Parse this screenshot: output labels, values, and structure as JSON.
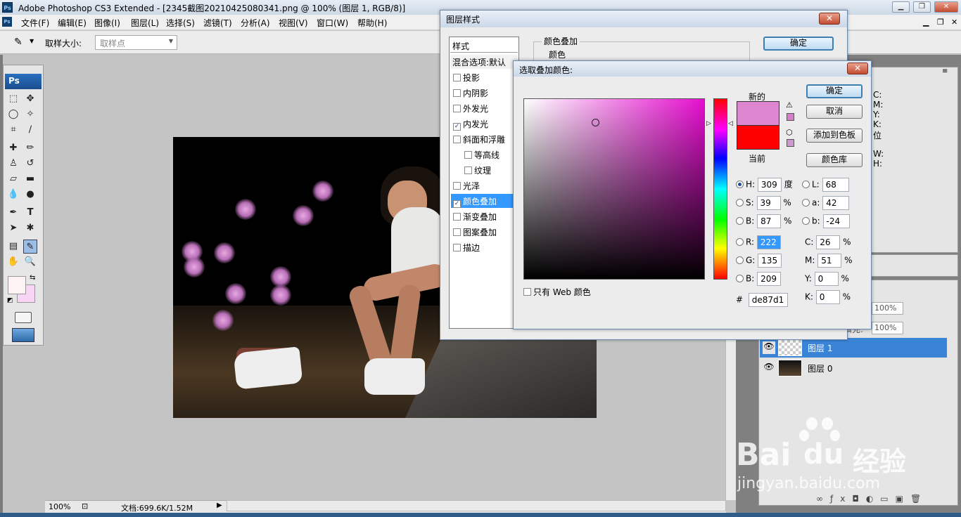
{
  "window": {
    "title": "Adobe Photoshop CS3 Extended - [2345截图20210425080341.png @ 100% (图层 1, RGB/8)]",
    "app_icon": "Ps"
  },
  "menubar": [
    "文件(F)",
    "编辑(E)",
    "图像(I)",
    "图层(L)",
    "选择(S)",
    "滤镜(T)",
    "分析(A)",
    "视图(V)",
    "窗口(W)",
    "帮助(H)"
  ],
  "options": {
    "sample_size_label": "取样大小:",
    "sample_size_value": "取样点"
  },
  "toolbox": {
    "logo": "Ps"
  },
  "status": {
    "zoom": "100%",
    "doc": "文档:699.6K/1.52M"
  },
  "layer_style": {
    "title": "图层样式",
    "list_header": "样式",
    "blend_options": "混合选项:默认",
    "items": [
      {
        "label": "投影",
        "checked": false
      },
      {
        "label": "内阴影",
        "checked": false
      },
      {
        "label": "外发光",
        "checked": false
      },
      {
        "label": "内发光",
        "checked": true
      },
      {
        "label": "斜面和浮雕",
        "checked": false
      },
      {
        "label": "等高线",
        "checked": false
      },
      {
        "label": "纹理",
        "checked": false
      },
      {
        "label": "光泽",
        "checked": false
      },
      {
        "label": "颜色叠加",
        "checked": true
      },
      {
        "label": "渐变叠加",
        "checked": false
      },
      {
        "label": "图案叠加",
        "checked": false
      },
      {
        "label": "描边",
        "checked": false
      }
    ],
    "section_title": "颜色叠加",
    "subsection": "颜色",
    "ok_button": "确定"
  },
  "picker": {
    "title": "选取叠加颜色:",
    "new_label": "新的",
    "current_label": "当前",
    "new_color": "#de87d1",
    "current_color": "#ff0000",
    "ok": "确定",
    "cancel": "取消",
    "add_swatch": "添加到色板",
    "color_library": "颜色库",
    "web_only": "只有 Web 颜色",
    "H": "309",
    "H_unit": "度",
    "S": "39",
    "S_unit": "%",
    "B": "87",
    "B_unit": "%",
    "R": "222",
    "G": "135",
    "B_rgb": "209",
    "L": "68",
    "a": "42",
    "b": "-24",
    "C": "26",
    "M": "51",
    "Y": "0",
    "K": "0",
    "pct": "%",
    "hex": "de87d1",
    "labels": {
      "H": "H:",
      "S": "S:",
      "B": "B:",
      "R": "R:",
      "G": "G:",
      "Bb": "B:",
      "L": "L:",
      "a": "a:",
      "b": "b:",
      "C": "C:",
      "M": "M:",
      "Y": "Y:",
      "K": "K:",
      "hash": "#"
    }
  },
  "info_panel": {
    "c": "C:",
    "m": "M:",
    "y": "Y:",
    "k": "K:",
    "bits": "位",
    "w": "W:",
    "h": "H:"
  },
  "layers": {
    "opacity": "100%",
    "fill_label": "填充:",
    "fill": "100%",
    "rows": [
      {
        "name": "图层 1"
      },
      {
        "name": "图层 0"
      }
    ]
  },
  "watermark": {
    "brand": "Bai",
    "brand2": "du",
    "cn": "经验",
    "url": "jingyan.baidu.com"
  }
}
